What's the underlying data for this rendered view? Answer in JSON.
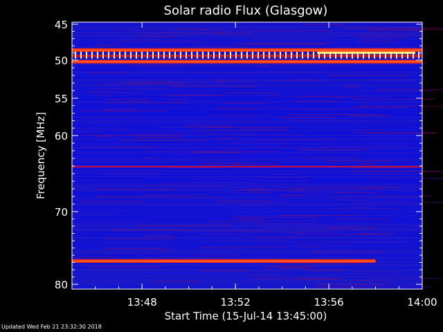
{
  "chart_data": {
    "type": "heatmap",
    "title": "Solar radio Flux (Glasgow)",
    "xlabel": "Start Time (15-Jul-14 13:45:00)",
    "ylabel": "Frequency [MHz]",
    "xlim": [
      "13:45:00",
      "14:00:00"
    ],
    "ylim": [
      45,
      80
    ],
    "y_reversed": true,
    "x_ticks": [
      "13:48",
      "13:52",
      "13:56",
      "14:00"
    ],
    "y_ticks": [
      45,
      50,
      55,
      60,
      70,
      80
    ],
    "y_axis_scale": "stretched below 60 MHz",
    "colormap": "blue-red-yellow",
    "colors": {
      "background": "#000000",
      "low": "#1010d8",
      "mid": "#c81040",
      "high": "#ff3010",
      "peak": "#ffff80"
    },
    "features": [
      {
        "name": "interference band",
        "frequency_mhz": 48.6,
        "x_start": "13:45:00",
        "x_end": "14:00:00",
        "intensity": "high"
      },
      {
        "name": "interference band",
        "frequency_mhz": 49.4,
        "x_start": "13:45:00",
        "x_end": "14:00:00",
        "intensity": "peak-spikes"
      },
      {
        "name": "interference band",
        "frequency_mhz": 50.2,
        "x_start": "13:45:00",
        "x_end": "14:00:00",
        "intensity": "high"
      },
      {
        "name": "interference band",
        "frequency_mhz": 64.1,
        "x_start": "13:45:00",
        "x_end": "14:00:00",
        "intensity": "mid"
      },
      {
        "name": "interference band",
        "frequency_mhz": 76.8,
        "x_start": "13:45:00",
        "x_end": "13:58:00",
        "intensity": "high"
      }
    ]
  },
  "footer": {
    "updated": "Updated Wed Feb 21 23:32:30 2018"
  }
}
